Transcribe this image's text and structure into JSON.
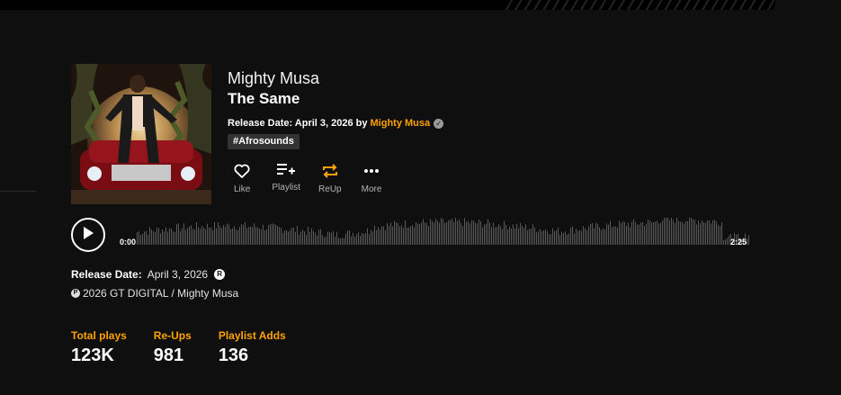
{
  "track": {
    "artist": "Mighty Musa",
    "title": "The Same",
    "release_prefix": "Release Date: April 3, 2026 by",
    "release_artist": "Mighty Musa",
    "genre_tag": "#Afrosounds"
  },
  "actions": [
    {
      "label": "Like",
      "icon": "heart-icon"
    },
    {
      "label": "Playlist",
      "icon": "playlist-add-icon"
    },
    {
      "label": "ReUp",
      "icon": "repost-icon"
    },
    {
      "label": "More",
      "icon": "more-dots-icon"
    }
  ],
  "player": {
    "current_time": "0:00",
    "duration": "2:25",
    "progress": 0
  },
  "details": {
    "release_label": "Release Date:",
    "release_value": "April 3, 2026",
    "copyright": "2026 GT DIGITAL / Mighty Musa"
  },
  "stats": [
    {
      "label": "Total plays",
      "value": "123K"
    },
    {
      "label": "Re-Ups",
      "value": "981"
    },
    {
      "label": "Playlist Adds",
      "value": "136"
    }
  ],
  "colors": {
    "accent": "#ffa200",
    "background": "#0f0f0f",
    "waveform": "#5a5a5a"
  }
}
